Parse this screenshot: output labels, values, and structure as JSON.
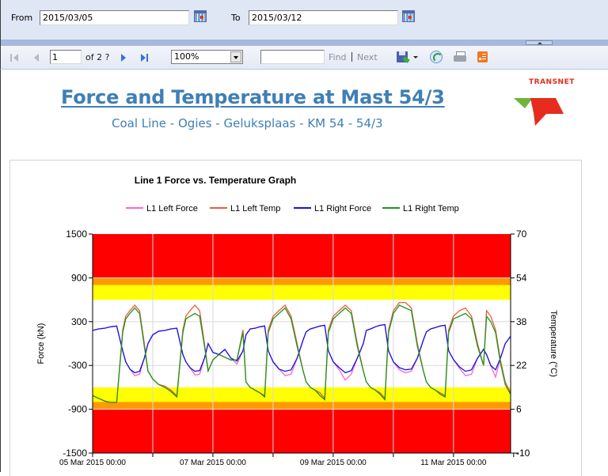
{
  "params": {
    "from_label": "From",
    "from_value": "2015/03/05",
    "to_label": "To",
    "to_value": "2015/03/12",
    "calendar_icon": "calendar-icon"
  },
  "toolbar": {
    "page_current": "1",
    "page_of": "of 2 ?",
    "zoom_value": "100%",
    "find_value": "",
    "find_label": "Find",
    "find_separator": "|",
    "next_label": "Next",
    "icons": [
      "first-page-icon",
      "previous-page-icon",
      "next-page-icon",
      "last-page-icon",
      "export-icon",
      "refresh-icon",
      "print-icon",
      "document-map-icon"
    ]
  },
  "report": {
    "title": "Force and Temperature at Mast 54/3",
    "subtitle": "Coal Line - Ogies - Geluksplaas - KM 54 - 54/3",
    "logo_text": "TRANSNET",
    "colors": {
      "title": "#3f7fb4",
      "logo_red": "#e52c1e",
      "logo_green": "#6fb43c"
    }
  },
  "chart_data": {
    "type": "line",
    "title": "Line 1 Force vs. Temperature Graph",
    "xlabel": "",
    "ylabel": "Force (kN)",
    "y2label": "Temperature (°C)",
    "ylim": [
      -1500,
      1500
    ],
    "y2lim": [
      -10,
      70
    ],
    "yticks": [
      -1500,
      -900,
      -300,
      300,
      900,
      1500
    ],
    "y2ticks": [
      -10,
      6,
      22,
      38,
      54,
      70
    ],
    "xlim_days": [
      0,
      6.95
    ],
    "xticks": [
      {
        "day": 0,
        "label": "05 Mar 2015 00:00"
      },
      {
        "day": 1,
        "label": ""
      },
      {
        "day": 2,
        "label": "07 Mar 2015 00:00"
      },
      {
        "day": 3,
        "label": ""
      },
      {
        "day": 4,
        "label": "09 Mar 2015 00:00"
      },
      {
        "day": 5,
        "label": ""
      },
      {
        "day": 6,
        "label": "11 Mar 2015 00:00"
      },
      {
        "day": 7,
        "label": ""
      }
    ],
    "grid": true,
    "legend_position": "top",
    "bands": [
      {
        "from": 900,
        "to": 1500,
        "color": "#ff0000"
      },
      {
        "from": 800,
        "to": 900,
        "color": "#ff9900"
      },
      {
        "from": 600,
        "to": 800,
        "color": "#ffff00"
      },
      {
        "from": -800,
        "to": -600,
        "color": "#ffff00"
      },
      {
        "from": -900,
        "to": -800,
        "color": "#ff9900"
      },
      {
        "from": -1500,
        "to": -900,
        "color": "#ff0000"
      }
    ],
    "x_days": [
      0.0,
      0.1,
      0.2,
      0.3,
      0.4,
      0.5,
      0.55,
      0.62,
      0.7,
      0.78,
      0.86,
      0.92,
      1.0,
      1.1,
      1.2,
      1.3,
      1.4,
      1.5,
      1.55,
      1.62,
      1.7,
      1.78,
      1.86,
      1.92,
      2.0,
      2.1,
      2.2,
      2.3,
      2.4,
      2.5,
      2.55,
      2.62,
      2.7,
      2.78,
      2.86,
      2.92,
      3.0,
      3.1,
      3.2,
      3.3,
      3.4,
      3.5,
      3.55,
      3.62,
      3.7,
      3.78,
      3.86,
      3.92,
      4.0,
      4.1,
      4.2,
      4.3,
      4.4,
      4.5,
      4.55,
      4.62,
      4.7,
      4.78,
      4.86,
      4.92,
      5.0,
      5.1,
      5.2,
      5.3,
      5.4,
      5.5,
      5.55,
      5.62,
      5.7,
      5.78,
      5.86,
      5.92,
      6.0,
      6.1,
      6.2,
      6.3,
      6.4,
      6.5,
      6.55,
      6.62,
      6.7,
      6.78,
      6.86,
      6.95
    ],
    "series": [
      {
        "name": "L1 Left Force",
        "color": "#ff66cc",
        "axis": "left",
        "values": [
          180,
          200,
          210,
          230,
          240,
          -100,
          -250,
          -350,
          -440,
          -420,
          -200,
          0,
          120,
          170,
          180,
          200,
          210,
          -150,
          -250,
          -330,
          -430,
          -420,
          -200,
          0,
          -120,
          -150,
          -80,
          -200,
          -280,
          -100,
          120,
          200,
          210,
          230,
          240,
          -100,
          -250,
          -350,
          -440,
          -420,
          -200,
          50,
          160,
          200,
          220,
          240,
          250,
          -100,
          -250,
          -360,
          -500,
          -420,
          -200,
          0,
          180,
          200,
          230,
          250,
          260,
          -100,
          -250,
          -360,
          -400,
          -380,
          -200,
          50,
          160,
          200,
          220,
          240,
          250,
          -100,
          -220,
          -340,
          -440,
          -420,
          -200,
          -80,
          -150,
          -300,
          -460,
          -200,
          0,
          100
        ]
      },
      {
        "name": "L1 Left Temp",
        "color": "#f05a3c",
        "axis": "right",
        "values": [
          11,
          10,
          9,
          8.5,
          8.5,
          35,
          40,
          42,
          44,
          42,
          30,
          20,
          17,
          15,
          14.5,
          13,
          11,
          35,
          40,
          42,
          44,
          42,
          30,
          20,
          24,
          26,
          25,
          24,
          24,
          35,
          16,
          14,
          13,
          12,
          11,
          35,
          40,
          42,
          44,
          40,
          30,
          20,
          16,
          14,
          13,
          12,
          10,
          35,
          40,
          42,
          44,
          42,
          30,
          20,
          16,
          14,
          13,
          12,
          10,
          35,
          42,
          45,
          45,
          43,
          30,
          20,
          16,
          14,
          13,
          12,
          11,
          35,
          40,
          42,
          43,
          40,
          30,
          22,
          42,
          40,
          35,
          24,
          16,
          12
        ]
      },
      {
        "name": "L1 Right Force",
        "color": "#1414e6",
        "axis": "right_force",
        "values": [
          180,
          200,
          210,
          230,
          240,
          -100,
          -250,
          -350,
          -400,
          -380,
          -200,
          0,
          120,
          170,
          180,
          200,
          210,
          -150,
          -250,
          -330,
          -380,
          -370,
          -200,
          0,
          -120,
          -150,
          -80,
          -200,
          -240,
          -100,
          120,
          200,
          210,
          230,
          240,
          -100,
          -250,
          -350,
          -380,
          -360,
          -200,
          50,
          160,
          200,
          220,
          240,
          250,
          -100,
          -250,
          -330,
          -400,
          -370,
          -200,
          0,
          180,
          200,
          230,
          250,
          260,
          -100,
          -250,
          -330,
          -360,
          -350,
          -200,
          50,
          160,
          200,
          220,
          240,
          250,
          -100,
          -220,
          -320,
          -380,
          -360,
          -200,
          -80,
          -150,
          -300,
          -360,
          -200,
          0,
          100
        ]
      },
      {
        "name": "L1 Right Temp",
        "color": "#1e961e",
        "axis": "right",
        "values": [
          11,
          10,
          9,
          8.5,
          8.5,
          34,
          39,
          41,
          43,
          41,
          29,
          20,
          17,
          15,
          14,
          12.5,
          10.5,
          34,
          39,
          40,
          41,
          40,
          29,
          20,
          24,
          26,
          25,
          24,
          24,
          34,
          16,
          14,
          13,
          12,
          10.5,
          34,
          39,
          41,
          43,
          39,
          29,
          20,
          16,
          14,
          13,
          11,
          9.5,
          34,
          39,
          41,
          43,
          41,
          29,
          20,
          16,
          14,
          13,
          11.5,
          9.5,
          34,
          41,
          44,
          43,
          42,
          29,
          20,
          16,
          14,
          13,
          11.5,
          10.5,
          34,
          39,
          40,
          41,
          39,
          29,
          22,
          40,
          38,
          34,
          23,
          15,
          11.5
        ]
      }
    ]
  }
}
